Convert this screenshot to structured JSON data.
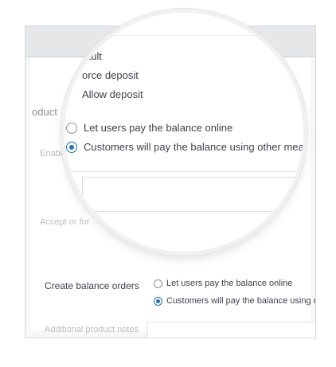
{
  "panel": {
    "section_title": "oduct",
    "faded_enable": "Enable d",
    "faded_accept": "Accept or for",
    "create_balance": {
      "label": "Create balance orders",
      "options": [
        {
          "label": "Let users pay the balance online",
          "checked": false
        },
        {
          "label": "Customers will pay the balance using ot",
          "checked": true
        }
      ]
    },
    "notes_label": "Additional product notes"
  },
  "lens": {
    "deposit_options": [
      "ault",
      "orce deposit",
      "Allow deposit"
    ],
    "balance_options": [
      {
        "label": "Let users pay the balance online",
        "checked": false
      },
      {
        "label": "Customers will pay the balance using other means",
        "checked": true
      }
    ]
  }
}
